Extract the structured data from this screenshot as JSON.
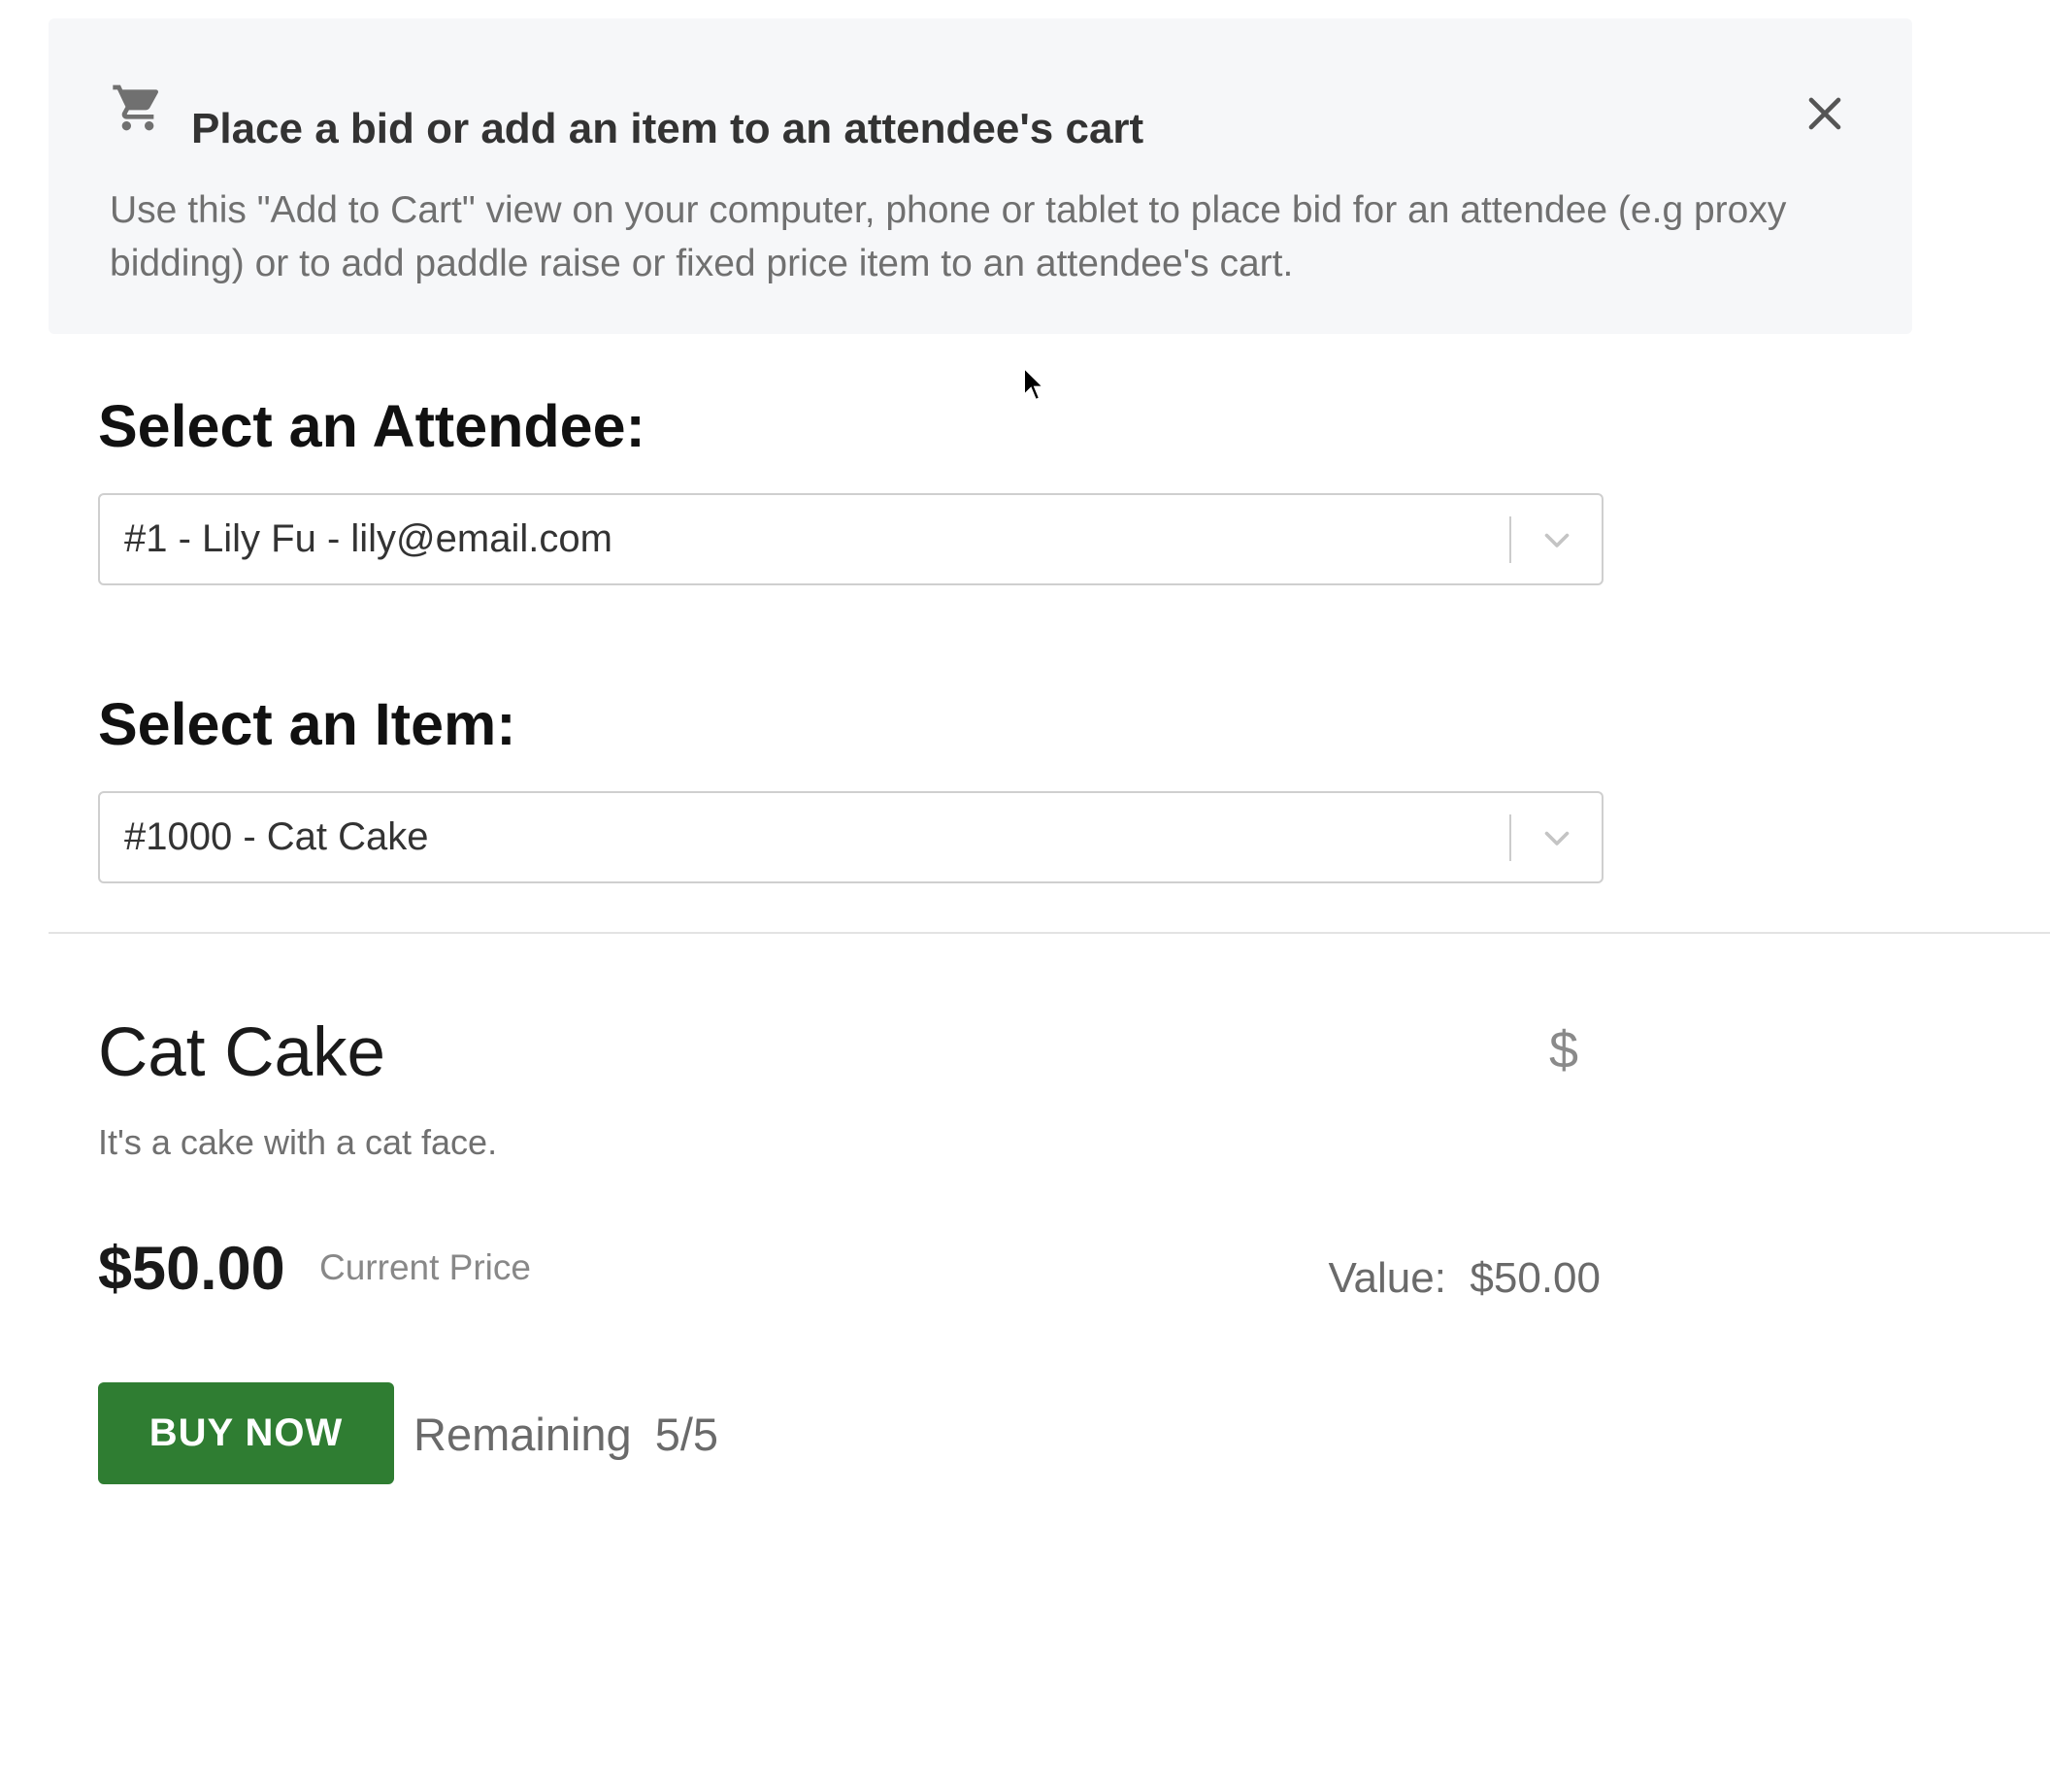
{
  "banner": {
    "icon": "shopping-cart-icon",
    "title": "Place a bid or add an item to an attendee's cart",
    "description": "Use this \"Add to Cart\" view on your computer, phone or tablet to place bid for an attendee (e.g proxy bidding) or to add paddle raise or fixed price item to an attendee's cart.",
    "close_icon": "close-icon"
  },
  "attendee": {
    "heading": "Select an Attendee:",
    "selected": "#1 - Lily Fu - lily@email.com"
  },
  "item_select": {
    "heading": "Select an Item:",
    "selected": "#1000 - Cat Cake"
  },
  "item": {
    "name": "Cat Cake",
    "currency_symbol": "$",
    "description": "It's a cake with a cat face.",
    "price": "$50.00",
    "price_label": "Current Price",
    "value_label": "Value:",
    "value": "$50.00",
    "buy_label": "BUY NOW",
    "remaining_label": "Remaining",
    "remaining_count": "5/5"
  },
  "colors": {
    "banner_bg": "#f6f7f9",
    "buy_button": "#2f7d32"
  }
}
